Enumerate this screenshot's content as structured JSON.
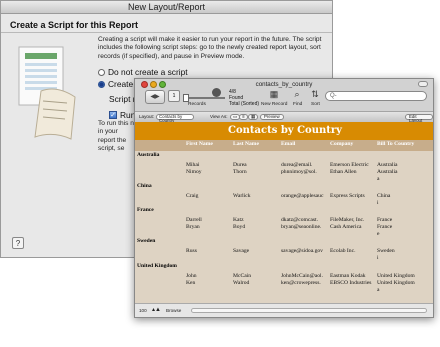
{
  "dialog": {
    "title": "New Layout/Report",
    "heading": "Create a Script for this Report",
    "description": "Creating a script will make it easier to run your report in the future. The script includes the following script steps: go to the newly created report layout, sort records (if specified), and pause in Preview mode.",
    "option_none": "Do not create a script",
    "option_create": "Create a",
    "script_name_label": "Script n",
    "run_label": "Run",
    "run_desc": "To run this n in your report the script, se"
  },
  "window": {
    "title": "contacts_by_country",
    "records_count": "4/8",
    "records_found": "Found",
    "records_total": "Total (Sorted)",
    "records_label": "Records",
    "new_record_label": "New Record",
    "find_label": "Find",
    "sort_label": "Sort",
    "search_placeholder": "Q-",
    "layout_label": "Layout:",
    "layout_value": "Contacts by Country",
    "view_as_label": "View As:",
    "preview_button": "Preview",
    "edit_layout_button": "Edit Layout",
    "status_zoom": "100",
    "status_mode": "Browse"
  },
  "report": {
    "title": "Contacts by Country",
    "columns": [
      "First Name",
      "Last Name",
      "Email",
      "Company",
      "Bill To Country"
    ],
    "groups": [
      {
        "country": "Australia",
        "rows": [
          [
            "Mihai",
            "Durea",
            "durea@email.",
            "Emerson Electric",
            "Australia"
          ],
          [
            "Nimoy",
            "Thorn",
            "phnnimoy@sol.",
            "Ethan Allen",
            "Australia"
          ]
        ],
        "extra": "a"
      },
      {
        "country": "China",
        "rows": [
          [
            "Craig",
            "Warlick",
            "orange@applesauc",
            "Express Scripts",
            "China"
          ]
        ],
        "extra": "i"
      },
      {
        "country": "France",
        "rows": [
          [
            "Darrell",
            "Katz",
            "dkatz@comcast.",
            "FileMaker, Inc.",
            "France"
          ],
          [
            "Bryan",
            "Boyd",
            "bryan@seaonline.",
            "Cash America",
            "France"
          ]
        ],
        "extra": "e"
      },
      {
        "country": "Sweden",
        "rows": [
          [
            "Russ",
            "Savage",
            "savage@sidoa.gov",
            "Ecolab Inc.",
            "Sweden"
          ]
        ],
        "extra": "i"
      },
      {
        "country": "United Kingdom",
        "rows": [
          [
            "John",
            "McCain",
            "JohnMcCain@aol.",
            "Eastman Kodak",
            "United Kingdom"
          ],
          [
            "Ken",
            "Walrod",
            "ken@crowepress.",
            "EBSCO Industries",
            "United Kingdom"
          ]
        ],
        "extra": "a"
      }
    ]
  },
  "colors": {
    "header_bg": "#d88b02",
    "report_bg": "#ded3c3",
    "column_bar": "#c7ad8b"
  }
}
